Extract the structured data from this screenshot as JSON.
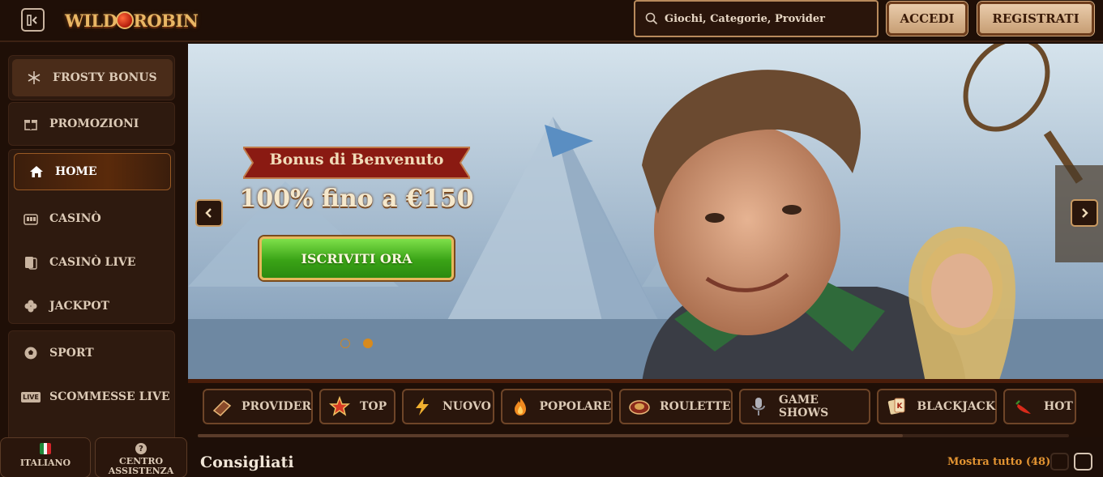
{
  "header": {
    "logo_text_left": "WILD",
    "logo_text_right": "ROBIN",
    "search_placeholder": "Giochi, Categorie, Provider",
    "login_label": "ACCEDI",
    "register_label": "REGISTRATI"
  },
  "sidebar": {
    "items": [
      {
        "label": "FROSTY BONUS",
        "icon": "snowflake-icon"
      },
      {
        "label": "PROMOZIONI",
        "icon": "gift-icon"
      },
      {
        "label": "HOME",
        "icon": "home-icon"
      },
      {
        "label": "CASINÒ",
        "icon": "slot-machine-icon"
      },
      {
        "label": "CASINÒ LIVE",
        "icon": "cards-icon"
      },
      {
        "label": "JACKPOT",
        "icon": "clover-icon"
      },
      {
        "label": "SPORT",
        "icon": "soccer-ball-icon"
      },
      {
        "label": "SCOMMESSE LIVE",
        "icon": "live-icon",
        "tag": "LIVE"
      }
    ],
    "language_label": "ITALIANO",
    "help_label_line1": "CENTRO",
    "help_label_line2": "ASSISTENZA"
  },
  "hero": {
    "ribbon_text": "Bonus di Benvenuto",
    "amount_text": "100% fino a €150",
    "cta_label": "ISCRIVITI ORA",
    "slide_count": 2,
    "active_slide": 2
  },
  "categories": [
    {
      "label": "PROVIDER",
      "icon": "book-icon"
    },
    {
      "label": "TOP",
      "icon": "star-icon"
    },
    {
      "label": "NUOVO",
      "icon": "lightning-icon"
    },
    {
      "label": "POPOLARE",
      "icon": "flame-icon"
    },
    {
      "label": "ROULETTE",
      "icon": "roulette-icon"
    },
    {
      "label": "GAME SHOWS",
      "icon": "microphone-icon"
    },
    {
      "label": "BLACKJACK",
      "icon": "playing-card-icon"
    },
    {
      "label": "HOT",
      "icon": "chili-pepper-icon"
    }
  ],
  "recommended": {
    "title": "Consigliati",
    "show_all": "Mostra tutto (48)"
  },
  "colors": {
    "background": "#1e0f08",
    "accent": "#e39432",
    "cta_green": "#3aa316",
    "gold": "#e9b765"
  }
}
